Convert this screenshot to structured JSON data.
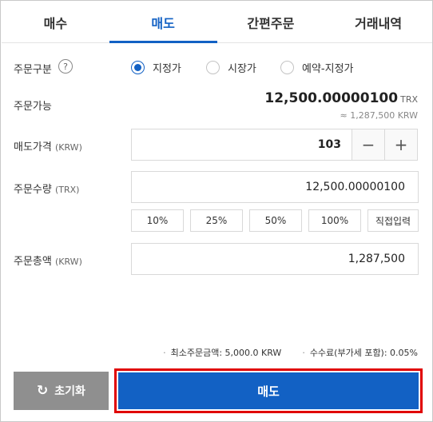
{
  "tabs": [
    {
      "label": "매수",
      "active": false
    },
    {
      "label": "매도",
      "active": true
    },
    {
      "label": "간편주문",
      "active": false
    },
    {
      "label": "거래내역",
      "active": false
    }
  ],
  "order_type": {
    "label": "주문구분",
    "help": "?",
    "options": [
      {
        "label": "지정가",
        "checked": true
      },
      {
        "label": "시장가",
        "checked": false
      },
      {
        "label": "예약-지정가",
        "checked": false
      }
    ]
  },
  "available": {
    "label": "주문가능",
    "amount": "12,500.00000100",
    "unit": "TRX",
    "approx": "≈ 1,287,500 KRW"
  },
  "price": {
    "label": "매도가격",
    "unit": "(KRW)",
    "value": "103",
    "minus": "−",
    "plus": "+"
  },
  "quantity": {
    "label": "주문수량",
    "unit": "(TRX)",
    "value": "12,500.00000100",
    "percent_buttons": [
      "10%",
      "25%",
      "50%",
      "100%",
      "직접입력"
    ]
  },
  "total": {
    "label": "주문총액",
    "unit": "(KRW)",
    "value": "1,287,500"
  },
  "notes": {
    "min_order": "최소주문금액: 5,000.0 KRW",
    "fee": "수수료(부가세 포함): 0.05%"
  },
  "buttons": {
    "reset": "초기화",
    "reset_icon": "refresh-icon",
    "sell": "매도"
  },
  "colors": {
    "accent": "#1261c4",
    "reset_bg": "#8f8f8f",
    "highlight_border": "#e00000"
  }
}
